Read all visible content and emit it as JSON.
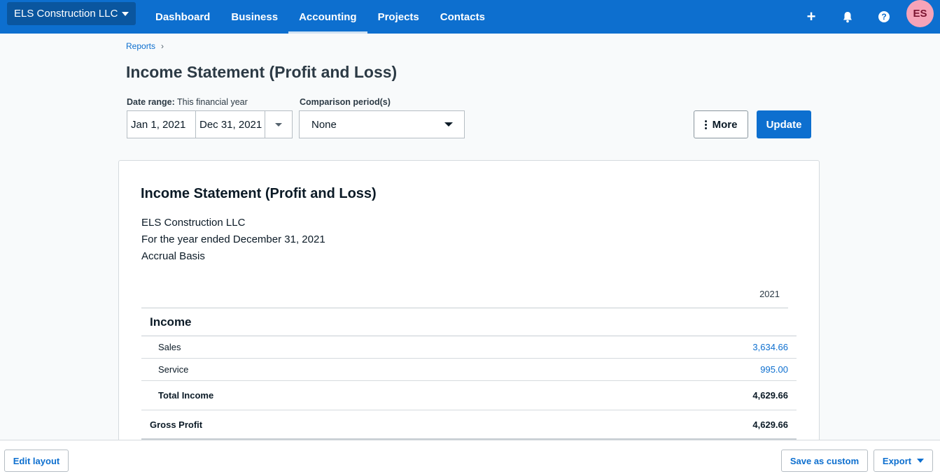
{
  "nav": {
    "org_name": "ELS Construction LLC",
    "links": [
      "Dashboard",
      "Business",
      "Accounting",
      "Projects",
      "Contacts"
    ],
    "active": "Accounting",
    "plus": "+",
    "help": "?",
    "avatar_initials": "ES",
    "brand_color": "#0d6fcf"
  },
  "breadcrumb": {
    "item": "Reports",
    "sep": "›"
  },
  "page": {
    "title": "Income Statement (Profit and Loss)"
  },
  "filters": {
    "date_range_label": "Date range:",
    "date_range_value": "This financial year",
    "start_date": "Jan 1, 2021",
    "end_date": "Dec 31, 2021",
    "comparison_label": "Comparison period(s)",
    "comparison_value": "None",
    "more_label": "More",
    "update_label": "Update"
  },
  "report": {
    "title": "Income Statement (Profit and Loss)",
    "company": "ELS Construction LLC",
    "period": "For the year ended December 31, 2021",
    "basis": "Accrual Basis",
    "column_header": "2021",
    "section_income": "Income",
    "rows": [
      {
        "label": "Sales",
        "value": "3,634.66"
      },
      {
        "label": "Service",
        "value": "995.00"
      }
    ],
    "total_income_label": "Total Income",
    "total_income_value": "4,629.66",
    "gross_profit_label": "Gross Profit",
    "gross_profit_value": "4,629.66"
  },
  "footer": {
    "edit_layout": "Edit layout",
    "save_as_custom": "Save as custom",
    "export": "Export"
  }
}
